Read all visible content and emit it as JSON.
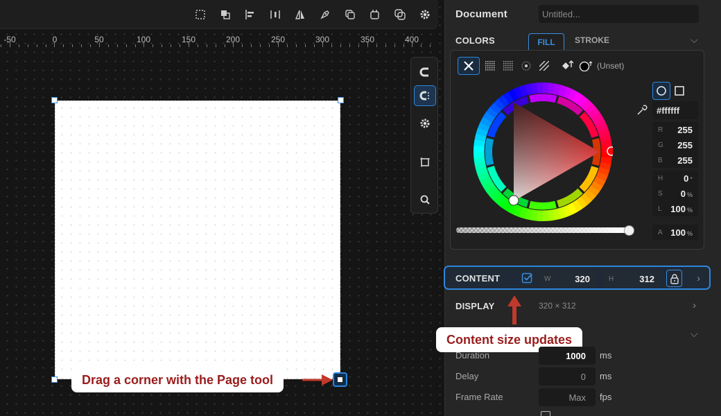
{
  "ruler": {
    "labels": [
      "-50",
      "0",
      "50",
      "100",
      "150",
      "200",
      "250",
      "300",
      "350",
      "400"
    ]
  },
  "callouts": {
    "drag": "Drag a corner with the Page tool",
    "content_size": "Content size updates"
  },
  "panel": {
    "document_label": "Document",
    "document_placeholder": "Untitled...",
    "colors_label": "COLORS",
    "tab_fill": "FILL",
    "tab_stroke": "STROKE",
    "unset_label": "(Unset)",
    "hex": "#ffffff",
    "rgb": {
      "r_label": "R",
      "r": "255",
      "g_label": "G",
      "g": "255",
      "b_label": "B",
      "b": "255"
    },
    "hsl": {
      "h_label": "H",
      "h": "0",
      "h_unit": "°",
      "s_label": "S",
      "s": "0",
      "s_unit": "%",
      "l_label": "L",
      "l": "100",
      "l_unit": "%"
    },
    "alpha": {
      "a_label": "A",
      "a": "100",
      "a_unit": "%",
      "slider_level": 1.0
    },
    "content": {
      "label": "CONTENT",
      "w_label": "W",
      "w": "320",
      "h_label": "H",
      "h": "312"
    },
    "display": {
      "label": "DISPLAY",
      "size": "320 × 312"
    },
    "animation": {
      "duration_label": "Duration",
      "duration": "1000",
      "duration_unit": "ms",
      "delay_label": "Delay",
      "delay": "0",
      "delay_unit": "ms",
      "framerate_label": "Frame Rate",
      "framerate": "Max",
      "framerate_unit": "fps"
    }
  },
  "colors": {
    "accent": "#2e86de",
    "callout_text": "#9a1c1c",
    "arrow": "#c0392b"
  }
}
